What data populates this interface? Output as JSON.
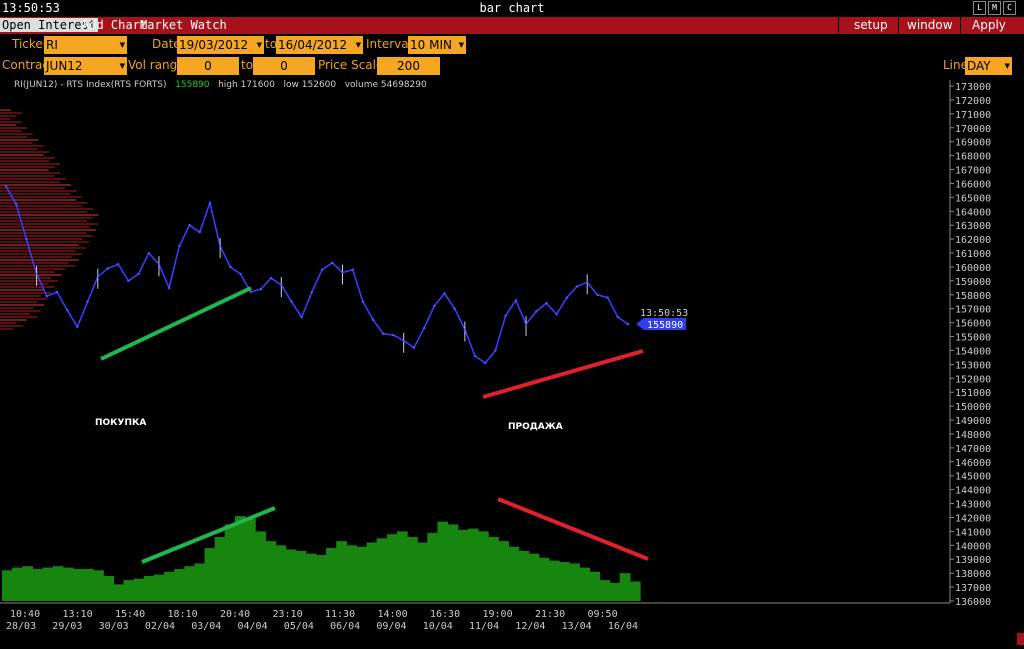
{
  "window": {
    "clock": "13:50:53",
    "title": "bar chart",
    "buttons": [
      "L",
      "M",
      "C"
    ]
  },
  "menu": {
    "left": [
      "Open Interest",
      "Add Chart",
      "Market Watch"
    ],
    "right": [
      "setup",
      "window",
      "Apply"
    ]
  },
  "controls": {
    "ticker_label": "Ticker",
    "ticker": "RI",
    "date_label": "Date",
    "date_from": "19/03/2012",
    "to_label": "to",
    "date_to": "16/04/2012",
    "interval_label": "Interval",
    "interval": "10 MIN",
    "contract_label": "Contract",
    "contract": "JUN12",
    "vol_range_label": "Vol range",
    "vol_from": "0",
    "vol_to_label": "to",
    "vol_to": "0",
    "price_scale_label": "Price Scale",
    "price_scale": "200",
    "line_label": "Line",
    "line": "DAY"
  },
  "info": {
    "instrument": "RI(JUN12) - RTS Index(RTS FORTS)",
    "last": "155890",
    "high": "high 171600",
    "low": "low 152600",
    "volume": "volume 54698290"
  },
  "chart_data": {
    "type": "line",
    "ylim": [
      136000,
      173000
    ],
    "yticks": [
      "173000",
      "172000",
      "171000",
      "170000",
      "169000",
      "168000",
      "167000",
      "166000",
      "165000",
      "164000",
      "163000",
      "162000",
      "161000",
      "160000",
      "159000",
      "158000",
      "157000",
      "156000",
      "155000",
      "154000",
      "153000",
      "152000",
      "151000",
      "150000",
      "149000",
      "148000",
      "147000",
      "146000",
      "145000",
      "144000",
      "143000",
      "142000",
      "141000",
      "140000",
      "139000",
      "138000",
      "137000",
      "136000"
    ],
    "xticks_time": [
      "10:40",
      "13:10",
      "15:40",
      "18:10",
      "20:40",
      "23:10",
      "11:30",
      "14:00",
      "16:30",
      "19:00",
      "21:30",
      "09:50"
    ],
    "xticks_date": [
      "28/03",
      "29/03",
      "30/03",
      "02/04",
      "03/04",
      "04/04",
      "05/04",
      "06/04",
      "09/04",
      "10/04",
      "11/04",
      "12/04",
      "13/04",
      "16/04"
    ],
    "price_series": {
      "name": "RI(JUN12)",
      "values": [
        165800,
        164500,
        162000,
        159500,
        157900,
        158200,
        156900,
        155700,
        157500,
        159300,
        159900,
        160200,
        159000,
        159500,
        161000,
        160200,
        158500,
        161500,
        163000,
        162500,
        164600,
        161500,
        160000,
        159500,
        158200,
        158400,
        159200,
        158700,
        157500,
        156400,
        158200,
        159800,
        160300,
        159600,
        159800,
        157500,
        156200,
        155200,
        155100,
        154700,
        154200,
        155600,
        157200,
        158100,
        157000,
        155500,
        153600,
        153100,
        154000,
        156500,
        157600,
        155900,
        156800,
        157400,
        156600,
        157800,
        158600,
        158900,
        158000,
        157800,
        156400,
        155890
      ]
    },
    "last_time": "13:50:53",
    "last_price": "155890",
    "open_interest_series": {
      "name": "Open Interest",
      "values": [
        138200,
        138400,
        138500,
        138300,
        138400,
        138500,
        138400,
        138300,
        138300,
        138200,
        137800,
        137200,
        137500,
        137600,
        137800,
        137900,
        138100,
        138300,
        138500,
        138700,
        139800,
        140600,
        141500,
        142100,
        141900,
        141000,
        140300,
        140000,
        139700,
        139600,
        139400,
        139300,
        139800,
        140300,
        140000,
        139900,
        140200,
        140500,
        140800,
        141000,
        140600,
        140200,
        140900,
        141700,
        141500,
        141100,
        141200,
        141000,
        140600,
        140300,
        139900,
        139600,
        139400,
        139100,
        138900,
        138800,
        138700,
        138400,
        138100,
        137500,
        137300,
        138000,
        137400
      ]
    },
    "annotations": [
      "ПОКУПКА",
      "ПРОДАЖА"
    ],
    "colors": {
      "price": "#3a3aff",
      "open_interest": "#16860f",
      "buy_line": "#1fb84c",
      "sell_line": "#e0202a",
      "last_price_tag": "#2f3cf0"
    }
  }
}
